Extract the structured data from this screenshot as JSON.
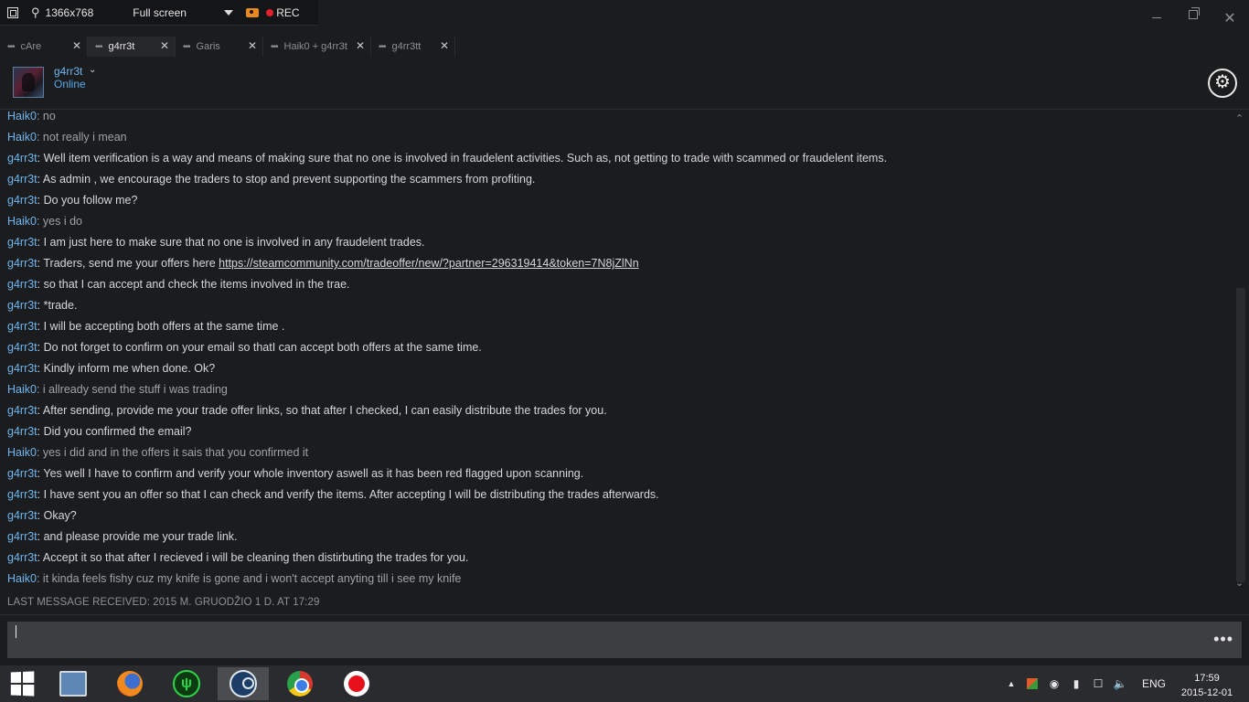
{
  "recorder": {
    "resolution": "1366x768",
    "mode": "Full screen",
    "rec_label": "REC"
  },
  "tabs": [
    {
      "label": "cAre",
      "active": false
    },
    {
      "label": "g4rr3t",
      "active": true
    },
    {
      "label": "Garis",
      "active": false
    },
    {
      "label": "Haik0 + g4rr3t",
      "active": false
    },
    {
      "label": "g4rr3tt",
      "active": false
    }
  ],
  "header": {
    "username": "g4rr3t",
    "status": "Online"
  },
  "messages": [
    {
      "author": "Haik0",
      "text": ": no"
    },
    {
      "author": "Haik0",
      "text": ": not really i mean"
    },
    {
      "author": "g4rr3t",
      "text": ": Well item verification is a way and means of making sure that no one is involved in fraudelent activities. Such as, not getting to trade with scammed or fraudelent items."
    },
    {
      "author": "g4rr3t",
      "text": ": As admin , we encourage the traders to stop and prevent supporting the scammers from profiting."
    },
    {
      "author": "g4rr3t",
      "text": ": Do you follow me?"
    },
    {
      "author": "Haik0",
      "text": ": yes i do"
    },
    {
      "author": "g4rr3t",
      "text": ": I am just here to make sure that no one is involved in any fraudelent trades."
    },
    {
      "author": "g4rr3t",
      "text": ": Traders, send me your offers here ",
      "link": "https://steamcommunity.com/tradeoffer/new/?partner=296319414&token=7N8jZlNn"
    },
    {
      "author": "g4rr3t",
      "text": ": so that I can accept and check the items involved in the trae."
    },
    {
      "author": "g4rr3t",
      "text": ": *trade."
    },
    {
      "author": "g4rr3t",
      "text": ": I will be accepting both offers at the same time ."
    },
    {
      "author": "g4rr3t",
      "text": ": Do not forget to confirm on your email so thatI can accept both offers at the same time."
    },
    {
      "author": "g4rr3t",
      "text": ": Kindly inform me when done. Ok?"
    },
    {
      "author": "Haik0",
      "text": ": i allready send the stuff i was trading"
    },
    {
      "author": "g4rr3t",
      "text": ": After sending, provide me your trade offer links, so that after I checked, I can easily distribute the trades for you."
    },
    {
      "author": "g4rr3t",
      "text": ": Did you confirmed the email?"
    },
    {
      "author": "Haik0",
      "text": ": yes i did and in the offers it sais that you confirmed it"
    },
    {
      "author": "g4rr3t",
      "text": ": Yes well I have to confirm and verify your whole inventory aswell as it has been red flagged upon scanning."
    },
    {
      "author": "g4rr3t",
      "text": ": I have sent you an offer so that I can check and verify the items. After accepting I will be distributing the trades afterwards."
    },
    {
      "author": "g4rr3t",
      "text": ": Okay?"
    },
    {
      "author": "g4rr3t",
      "text": ": and please provide me your trade link."
    },
    {
      "author": "g4rr3t",
      "text": ": Accept it so that after I recieved i will be cleaning then distirbuting the trades for you."
    },
    {
      "author": "Haik0",
      "text": ": it kinda feels fishy cuz my knife is gone and i won't accept anyting till i see my knife"
    }
  ],
  "last_message": "LAST MESSAGE RECEIVED: 2015 M. GRUODŽIO 1 D. AT 17:29",
  "input": {
    "value": "",
    "more": "•••"
  },
  "taskbar": {
    "apps": [
      "start",
      "explorer",
      "firefox",
      "green-app",
      "steam",
      "chrome",
      "recorder"
    ],
    "active_app": "steam",
    "language": "ENG",
    "time": "17:59",
    "date": "2015-12-01"
  },
  "colors": {
    "accent": "#6fb6f0",
    "background": "#1b1c1e",
    "input": "#3d3e41",
    "taskbar": "#2a2b2e"
  }
}
